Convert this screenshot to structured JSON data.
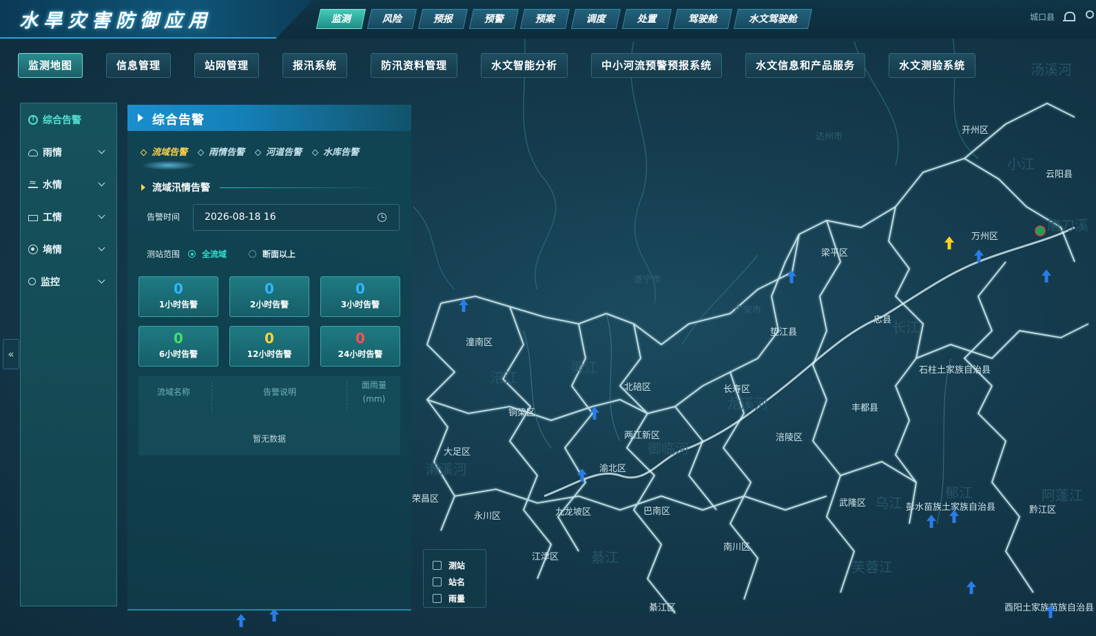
{
  "header": {
    "app_title": "水旱灾害防御应用",
    "user_name": "城口县",
    "top_tabs": [
      "监测",
      "风险",
      "预报",
      "预警",
      "预案",
      "调度",
      "处置",
      "驾驶舱",
      "水文驾驶舱"
    ]
  },
  "sub_nav": [
    "监测地图",
    "信息管理",
    "站网管理",
    "报汛系统",
    "防汛资料管理",
    "水文智能分析",
    "中小河流预警预报系统",
    "水文信息和产品服务",
    "水文测验系统"
  ],
  "sidebar": {
    "items": [
      {
        "label": "综合告警",
        "icon": "warning-icon"
      },
      {
        "label": "雨情",
        "icon": "cloud-rain-icon"
      },
      {
        "label": "水情",
        "icon": "water-icon"
      },
      {
        "label": "工情",
        "icon": "building-icon"
      },
      {
        "label": "墒情",
        "icon": "soil-icon"
      },
      {
        "label": "监控",
        "icon": "camera-icon"
      }
    ]
  },
  "panel": {
    "title": "综合告警",
    "alert_tabs": [
      "流域告警",
      "雨情告警",
      "河道告警",
      "水库告警"
    ],
    "section_title": "流域汛情告警",
    "time_label": "告警时间",
    "time_value": "2026-08-18 16",
    "scope_label": "测站范围",
    "scope_options": [
      "全流域",
      "断面以上"
    ],
    "stats": [
      {
        "value": "0",
        "label": "1小时告警",
        "color": "#2fb6ff"
      },
      {
        "value": "0",
        "label": "2小时告警",
        "color": "#2fb6ff"
      },
      {
        "value": "0",
        "label": "3小时告警",
        "color": "#2fb6ff"
      },
      {
        "value": "0",
        "label": "6小时告警",
        "color": "#3ee06a"
      },
      {
        "value": "0",
        "label": "12小时告警",
        "color": "#ffd23a"
      },
      {
        "value": "0",
        "label": "24小时告警",
        "color": "#ff4f4f"
      }
    ],
    "table": {
      "columns": [
        "流域名称",
        "告警说明",
        "面雨量",
        "(mm)"
      ],
      "empty_text": "暂无数据"
    }
  },
  "map": {
    "districts": [
      "开州区",
      "云阳县",
      "万州区",
      "梁平区",
      "忠县",
      "垫江县",
      "石柱土家族自治县",
      "丰都县",
      "长寿区",
      "北碚区",
      "潼南区",
      "铜梁区",
      "渝北区",
      "两江新区",
      "涪陵区",
      "大足区",
      "永川区",
      "九龙坡区",
      "巴南区",
      "武隆区",
      "彭水苗族土家族自治县",
      "黔江区",
      "江津区",
      "南川区",
      "綦江区",
      "酉阳土家族苗族自治县",
      "荣昌区",
      "达州市",
      "广安市",
      "遂宁市"
    ],
    "rivers": [
      "渠江",
      "涪江",
      "龙溪河",
      "御临河",
      "长江",
      "小江",
      "濑溪河",
      "綦江",
      "乌江",
      "郁江",
      "阿蓬江",
      "芙蓉江",
      "州河",
      "汤溪河",
      "磨刀溪"
    ]
  },
  "layers": [
    "测站",
    "站名",
    "雨量"
  ],
  "colors": {
    "accent": "#2ee0d0",
    "active_tab": "#ffd24a",
    "header_blue": "#1a8fcf"
  }
}
